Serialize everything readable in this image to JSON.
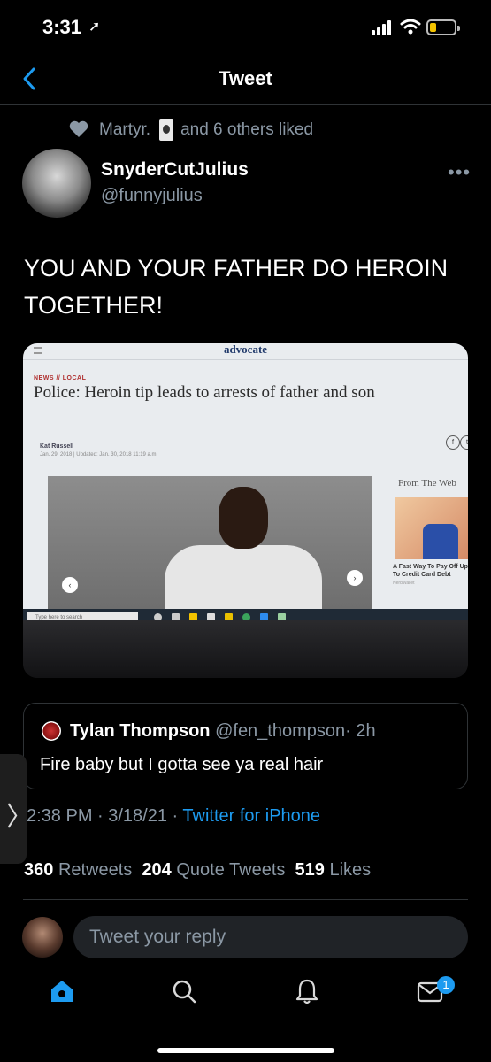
{
  "status_bar": {
    "time": "3:31",
    "location_glyph": "➚"
  },
  "header": {
    "back_label": "back",
    "title": "Tweet"
  },
  "social_context": {
    "prefix": "Martyr.",
    "suffix": "and 6 others liked"
  },
  "author": {
    "display_name": "SnyderCutJulius",
    "handle": "@funnyjulius"
  },
  "tweet": {
    "text": "YOU AND YOUR FATHER DO HEROIN TOGETHER!"
  },
  "media": {
    "masthead": "advocate",
    "kicker": "NEWS // LOCAL",
    "headline": "Police: Heroin tip leads to arrests of father and son",
    "byline": "Kat Russell",
    "dateline": "Jan. 29, 2018 | Updated: Jan. 30, 2018 11:19 a.m.",
    "share_facebook": "f",
    "share_twitter": "t",
    "carousel_prev": "‹",
    "carousel_next": "›",
    "from_the_web": "From The Web",
    "ad_caption": "A Fast Way To Pay Off Up To Credit Card Debt",
    "ad_source": "NerdWallet",
    "taskbar_search": "Type here to search"
  },
  "quoted_tweet": {
    "name": "Tylan Thompson",
    "handle": "@fen_thompson",
    "age": "· 2h",
    "text": "Fire baby but I gotta see ya real hair"
  },
  "meta": {
    "timestamp": "2:38 PM · 3/18/21 · ",
    "source": "Twitter for iPhone"
  },
  "stats": {
    "retweets": "360",
    "retweets_label": "Retweets",
    "quotes": "204",
    "quotes_label": "Quote Tweets",
    "likes": "519",
    "likes_label": "Likes"
  },
  "side_tab": {
    "glyph": "〉"
  },
  "reply": {
    "placeholder": "Tweet your reply"
  },
  "tab_bar": {
    "messages_badge": "1"
  },
  "colors": {
    "accent": "#1d9bf0",
    "background": "#000000",
    "secondary_text": "#8b98a5",
    "divider": "#2f3336"
  }
}
